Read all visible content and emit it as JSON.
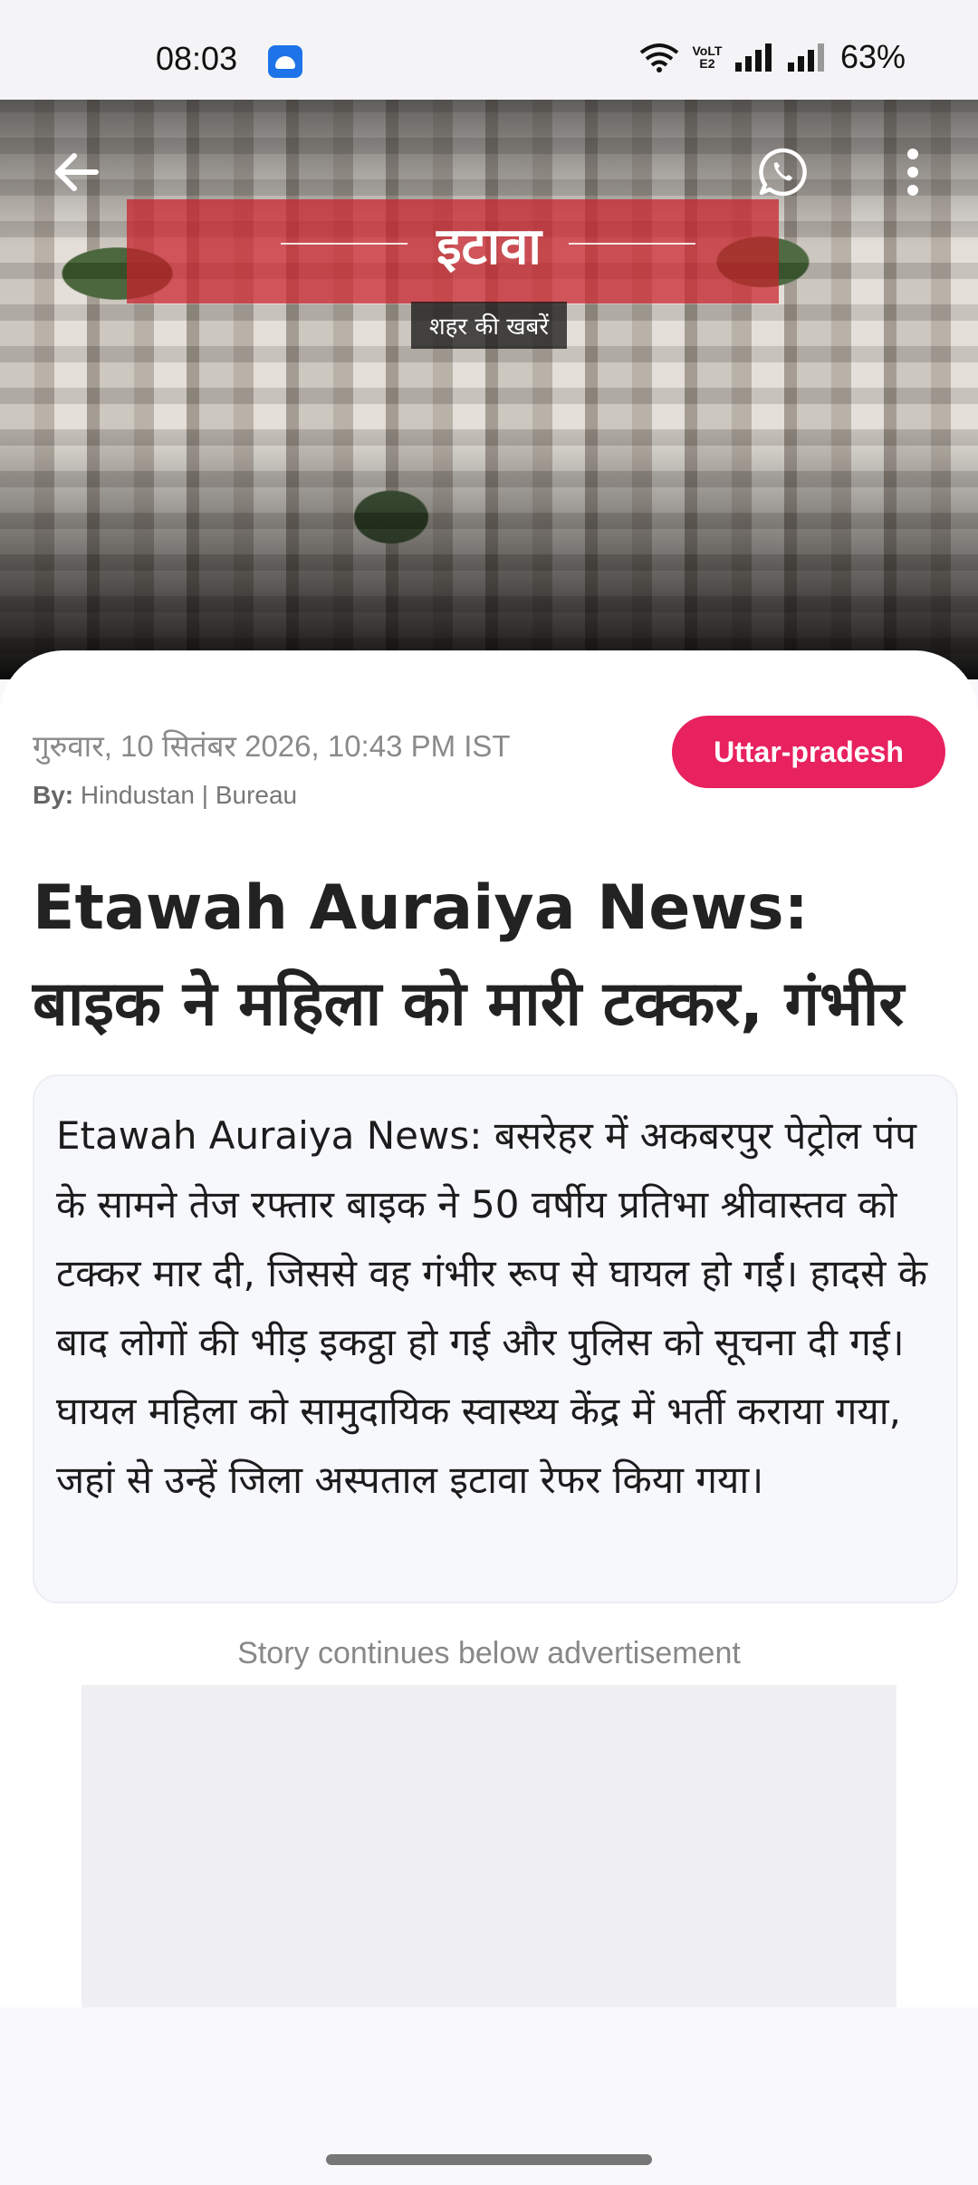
{
  "status_bar": {
    "time": "08:03",
    "battery": "63%",
    "network_label": "VoLTE2",
    "icons": [
      "android-notification-icon",
      "wifi-icon",
      "volte-icon",
      "signal-icon",
      "signal-icon"
    ]
  },
  "toolbar": {
    "back_icon": "arrow-left-icon",
    "share_icon": "whatsapp-icon",
    "menu_icon": "more-vertical-icon"
  },
  "hero": {
    "city_title": "इटावा",
    "city_subtitle": "शहर की खबरें"
  },
  "article": {
    "date": "गुरुवार, 10 सितंबर 2026, 10:43 PM IST",
    "by_label": "By:",
    "author": "Hindustan | Bureau",
    "category": "Uttar-pradesh",
    "headline": "Etawah Auraiya News: बाइक ने महिला को मारी टक्कर, गंभीर",
    "summary": "Etawah Auraiya News: बसरेहर में अकबरपुर पेट्रोल पंप के सामने तेज रफ्तार बाइक ने 50 वर्षीय प्रतिभा श्रीवास्तव को टक्कर मार दी, जिससे वह गंभीर रूप से घायल हो गईं। हादसे के बाद लोगों की भीड़ इकट्ठा हो गई और पुलिस को सूचना दी गई। घायल महिला को सामुदायिक स्वास्थ्य केंद्र में भर्ती कराया गया, जहां से उन्हें जिला अस्पताल इटावा रेफर किया गया।"
  },
  "ad": {
    "label": "Story continues below advertisement"
  },
  "colors": {
    "category_badge": "#e8215f",
    "city_band": "#c81e28"
  }
}
